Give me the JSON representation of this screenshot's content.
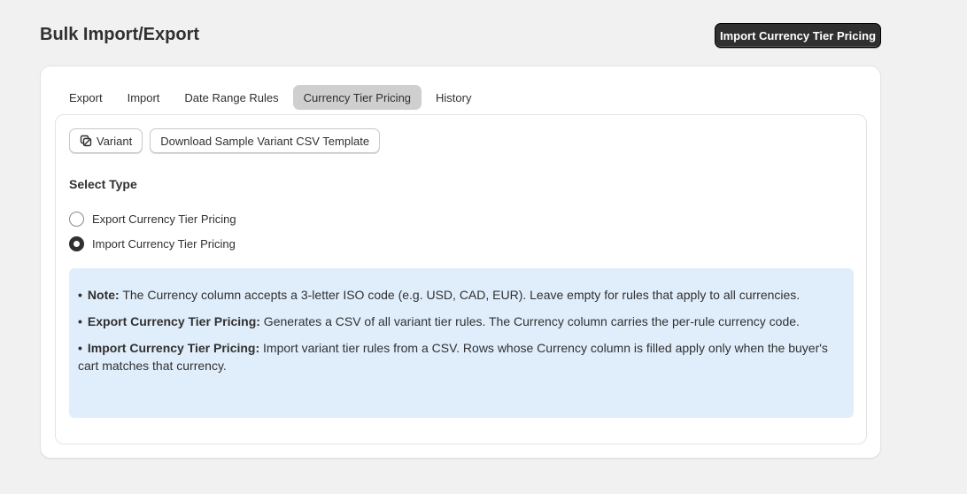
{
  "header": {
    "title": "Bulk Import/Export",
    "primary_action": "Import Currency Tier Pricing"
  },
  "tabs": [
    {
      "label": "Export",
      "active": false
    },
    {
      "label": "Import",
      "active": false
    },
    {
      "label": "Date Range Rules",
      "active": false
    },
    {
      "label": "Currency Tier Pricing",
      "active": true
    },
    {
      "label": "History",
      "active": false
    }
  ],
  "toolbar": {
    "variant_label": "Variant",
    "variant_icon": "variant-icon",
    "download_label": "Download Sample Variant CSV Template"
  },
  "select_type": {
    "title": "Select Type",
    "options": [
      {
        "label": "Export Currency Tier Pricing",
        "checked": false
      },
      {
        "label": "Import Currency Tier Pricing",
        "checked": true
      }
    ]
  },
  "notes": [
    {
      "bold": "Note:",
      "text": " The Currency column accepts a 3-letter ISO code (e.g. USD, CAD, EUR). Leave empty for rules that apply to all currencies."
    },
    {
      "bold": "Export Currency Tier Pricing:",
      "text": " Generates a CSV of all variant tier rules. The Currency column carries the per-rule currency code."
    },
    {
      "bold": "Import Currency Tier Pricing:",
      "text": " Import variant tier rules from a CSV. Rows whose Currency column is filled apply only when the buyer's cart matches that currency."
    }
  ],
  "colors": {
    "primary_button": "#303030",
    "active_tab": "#cfcfcf",
    "info_background": "#e0eefc",
    "page_background": "#f1f1f1"
  }
}
